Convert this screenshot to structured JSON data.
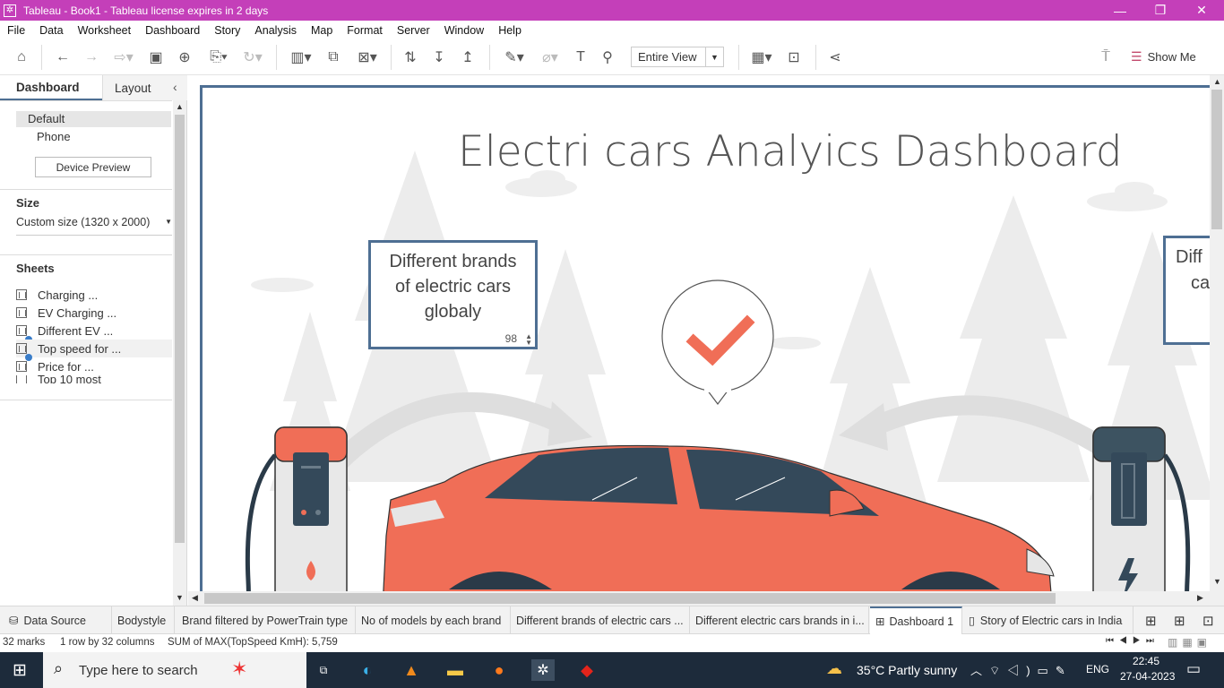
{
  "window": {
    "title": "Tableau - Book1 - Tableau license expires in 2 days"
  },
  "menu": [
    "File",
    "Data",
    "Worksheet",
    "Dashboard",
    "Story",
    "Analysis",
    "Map",
    "Format",
    "Server",
    "Window",
    "Help"
  ],
  "toolbar": {
    "fit_value": "Entire View",
    "show_me": "Show Me"
  },
  "left_pane": {
    "tabs": {
      "dashboard": "Dashboard",
      "layout": "Layout"
    },
    "device": {
      "default": "Default",
      "phone": "Phone",
      "preview_button": "Device Preview"
    },
    "size": {
      "header": "Size",
      "value": "Custom size (1320 x 2000)"
    },
    "sheets": {
      "header": "Sheets",
      "items": [
        "Charging ...",
        "EV Charging ...",
        "Different EV ...",
        "Top speed for ...",
        "Price for ...",
        "Top 10 most"
      ]
    }
  },
  "dashboard": {
    "title": "Electri cars Analyics Dashboard",
    "kpi_left": {
      "caption": "Different brands of electric cars globaly",
      "value": "98"
    },
    "kpi_right": {
      "caption_line1": "Diff",
      "caption_line2": "ca"
    }
  },
  "sheet_tabs": [
    "Data Source",
    "Bodystyle",
    "Brand filtered by PowerTrain type",
    "No of models by each brand",
    "Different brands of electric cars ...",
    "Different electric cars brands in i...",
    "Dashboard 1",
    "Story of Electric cars in India"
  ],
  "status": {
    "marks": "32 marks",
    "rows_cols": "1 row by 32 columns",
    "sum": "SUM of MAX(TopSpeed KmH): 5,759"
  },
  "taskbar": {
    "search_placeholder": "Type here to search",
    "weather": "35°C  Partly sunny",
    "lang": "ENG",
    "time": "22:45",
    "date": "27-04-2023"
  },
  "colors": {
    "titlebar": "#c43fb9",
    "accent": "#4e6f93",
    "car": "#f06e57",
    "check": "#f06e57"
  }
}
